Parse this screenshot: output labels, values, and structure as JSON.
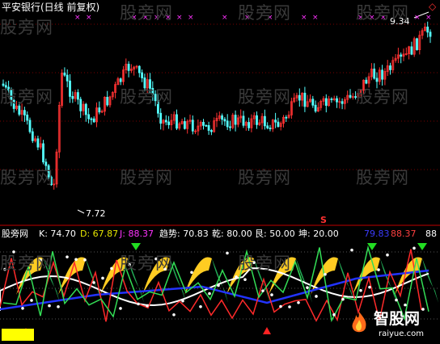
{
  "header": {
    "title": "平安银行(日线 前复权)"
  },
  "price_pane": {
    "high_marker": "9.34",
    "low_marker": "7.72",
    "corner_symbol": "◇"
  },
  "indicator_pane": {
    "name": "股旁网",
    "params": [
      {
        "label": "K: 74.70",
        "color": "#ffffff"
      },
      {
        "label": "D: 67.87",
        "color": "#e6e600"
      },
      {
        "label": "J: 88.37",
        "color": "#ff33ff"
      },
      {
        "label": "趋势: 70.83",
        "color": "#ffffff"
      },
      {
        "label": "乾: 80.00",
        "color": "#ffffff"
      },
      {
        "label": "艮: 50.00",
        "color": "#ffffff"
      },
      {
        "label": "坤: 20.00",
        "color": "#ffffff"
      }
    ],
    "right_values": [
      {
        "label": "79.83",
        "color": "#3b3bff"
      },
      {
        "label": "88.37",
        "color": "#ff4040"
      },
      {
        "label": "88",
        "color": "#ffffff"
      }
    ],
    "signal_mark": "S"
  },
  "watermarks": [
    "股旁网",
    "股旁网",
    "股旁网",
    "股旁网",
    "股旁网",
    "股旁网",
    "股旁网",
    "股旁网",
    "股旁网",
    "股旁网",
    "股旁网",
    "股旁网",
    "股旁网",
    "股旁网",
    "股旁网"
  ],
  "logo": {
    "brand": "智股网",
    "url_text": "raiyue.com"
  },
  "colors": {
    "up": "#ff3232",
    "down": "#54ffff",
    "grid": "#7a0000",
    "axis": "#c00000"
  }
}
